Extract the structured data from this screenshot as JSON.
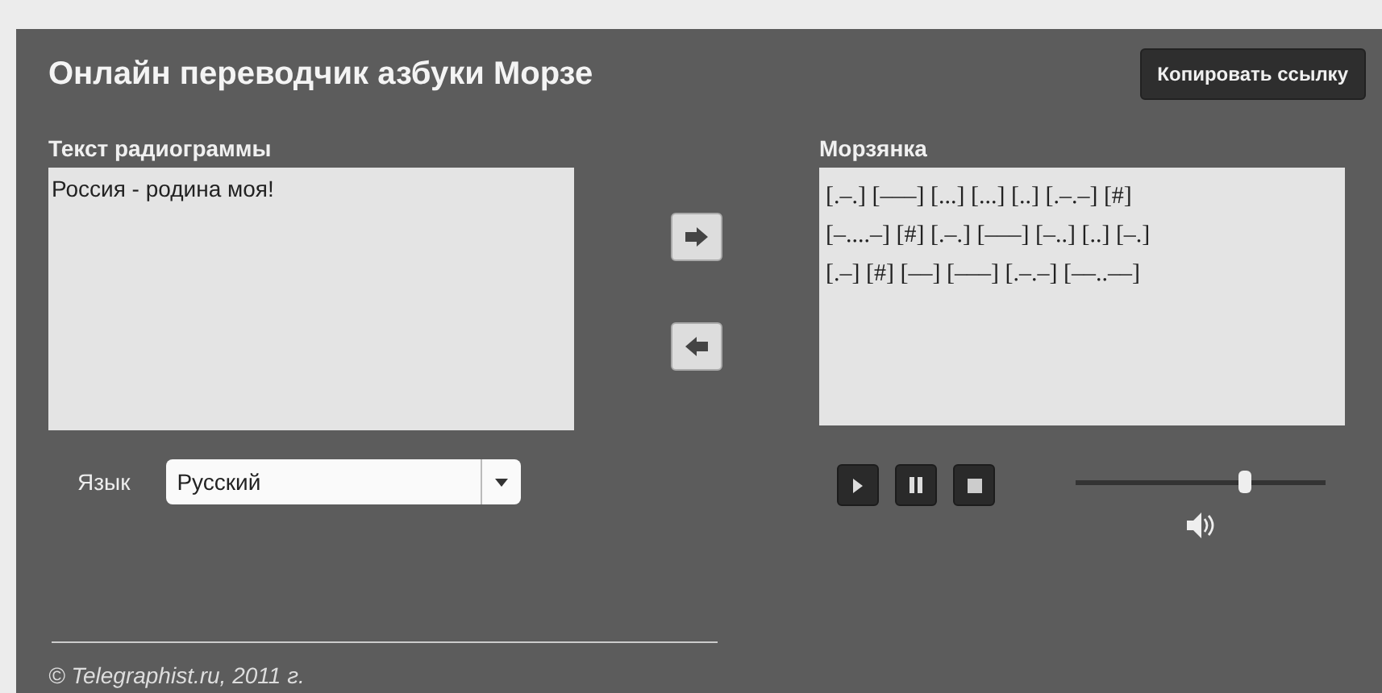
{
  "header": {
    "title": "Онлайн переводчик азбуки Морзе",
    "copy_link_button": "Копировать ссылку"
  },
  "input": {
    "label": "Текст радиограммы",
    "value": "Россия - родина моя!"
  },
  "output": {
    "label": "Морзянка",
    "lines": [
      "[.–.] [–––] [...] [...] [..] [.–.–] [#]",
      "[–....–] [#] [.–.] [–––] [–..] [..] [–.]",
      "[.–] [#] [––] [–––] [.–.–] [––..––]"
    ]
  },
  "language": {
    "label": "Язык",
    "value": "Русский"
  },
  "player": {
    "volume": {
      "level": 0.68
    }
  },
  "footer": "© Telegraphist.ru, 2011 г."
}
